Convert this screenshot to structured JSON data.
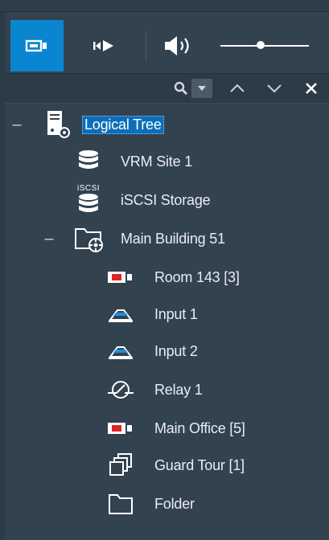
{
  "toolbar": {
    "camera_view_button": "camera-view",
    "playback_button": "playback",
    "volume_button": "volume",
    "volume_level": 0.45
  },
  "search": {
    "search_icon": "search-icon",
    "dropdown_icon": "chevron-down-icon",
    "prev_icon": "chevron-up-icon",
    "next_icon": "chevron-down-icon",
    "close_icon": "close-icon"
  },
  "tree": {
    "root": {
      "label": "Logical Tree",
      "expander": "–"
    },
    "vrm": {
      "label": "VRM Site 1"
    },
    "iscsi": {
      "label": "iSCSI Storage",
      "badge": "iSCSI"
    },
    "building": {
      "label": "Main Building 51",
      "expander": "–"
    },
    "room143": {
      "label": "Room 143 [3]"
    },
    "input1": {
      "label": "Input 1"
    },
    "input2": {
      "label": "Input 2"
    },
    "relay1": {
      "label": "Relay 1"
    },
    "mainoffice": {
      "label": "Main Office [5]"
    },
    "guardtour": {
      "label": "Guard Tour [1]"
    },
    "folder": {
      "label": "Folder"
    }
  },
  "colors": {
    "accent": "#0a86d1",
    "selection": "#0a6fb8",
    "panel": "#33424f",
    "alarm_red": "#e0242a",
    "input_blue": "#1f8fe0"
  }
}
